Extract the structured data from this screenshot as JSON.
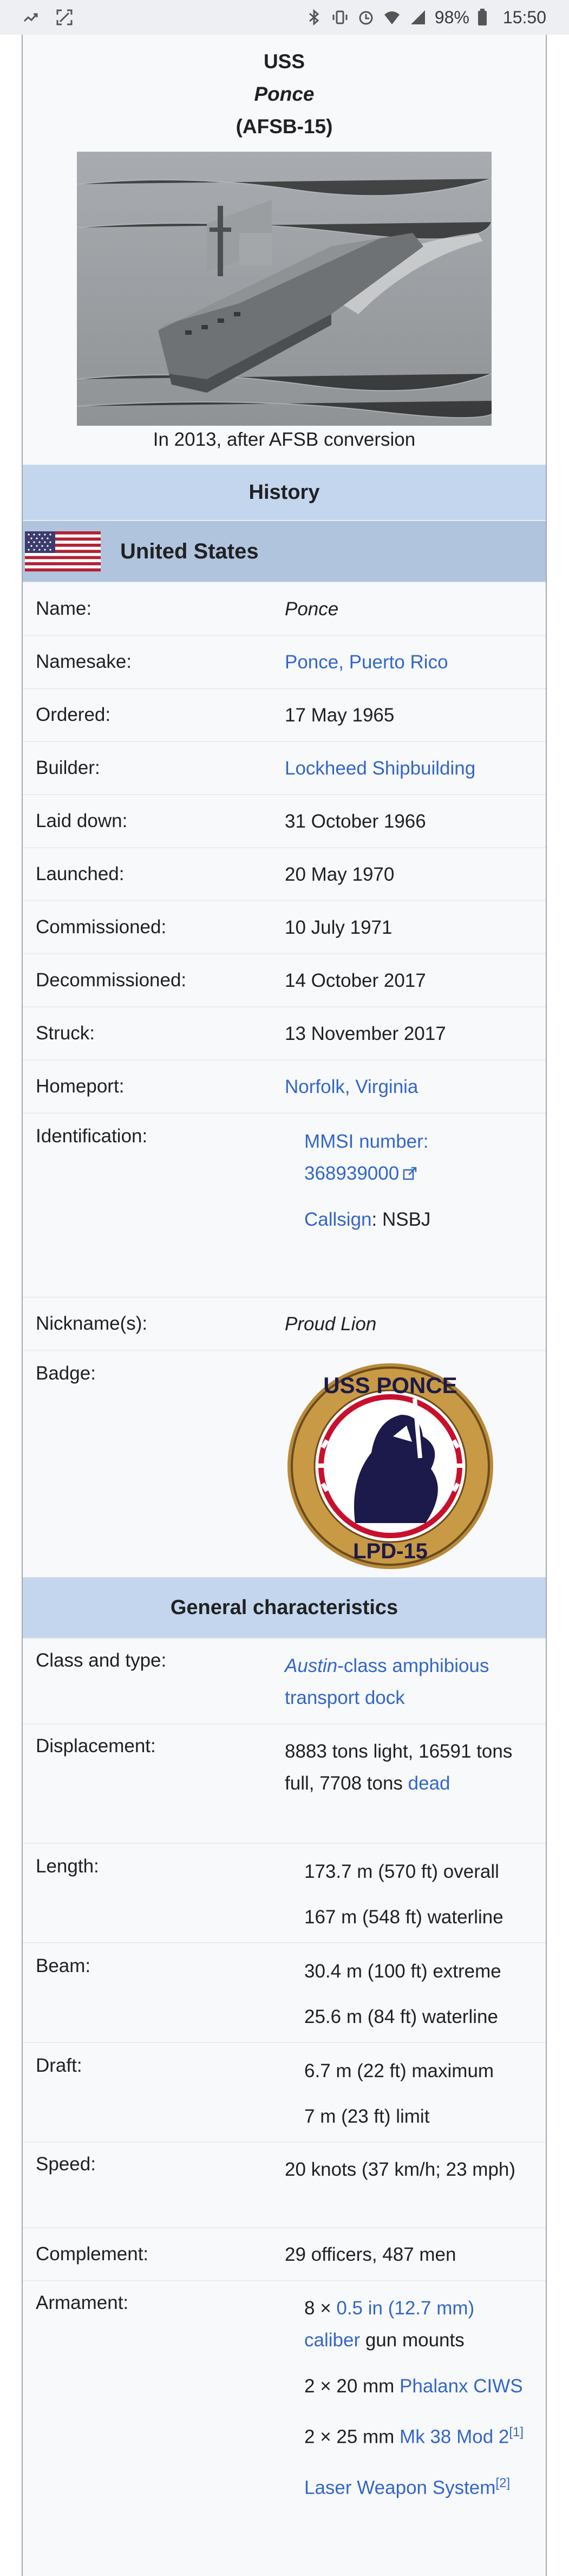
{
  "status": {
    "battery": "98%",
    "time": "15:50"
  },
  "infobox": {
    "title_prefix": "USS",
    "title_name": "Ponce",
    "title_hull": "(AFSB-15)",
    "caption": "In 2013, after AFSB conversion",
    "history_header": "History",
    "country": "United States",
    "history": {
      "name_label": "Name:",
      "name_value": "Ponce",
      "namesake_label": "Namesake:",
      "namesake_value": "Ponce, Puerto Rico",
      "ordered_label": "Ordered:",
      "ordered_value": "17 May 1965",
      "builder_label": "Builder:",
      "builder_value": "Lockheed Shipbuilding",
      "laid_label": "Laid down:",
      "laid_value": "31 October 1966",
      "launched_label": "Launched:",
      "launched_value": "20 May 1970",
      "commissioned_label": "Commissioned:",
      "commissioned_value": "10 July 1971",
      "decommissioned_label": "Decommissioned:",
      "decommissioned_value": "14 October 2017",
      "struck_label": "Struck:",
      "struck_value": "13 November 2017",
      "homeport_label": "Homeport:",
      "homeport_value": "Norfolk, Virginia",
      "ident_label": "Identification:",
      "mmsi_label": "MMSI number:",
      "mmsi_value": "368939000",
      "callsign_label": "Callsign",
      "callsign_value": ": NSBJ",
      "nickname_label": "Nickname(s):",
      "nickname_value": "Proud Lion",
      "badge_label": "Badge:",
      "badge_top_text": "USS PONCE",
      "badge_bottom_text": "LPD-15"
    },
    "general_header": "General characteristics",
    "general": {
      "class_label": "Class and type:",
      "class_italic": "Austin",
      "class_rest": "-class amphibious transport dock",
      "disp_label": "Displacement:",
      "disp_text": "8883 tons light, 16591 tons full, 7708 tons ",
      "disp_link": "dead",
      "length_label": "Length:",
      "length_1": "173.7 m (570 ft) overall",
      "length_2": "167 m (548 ft) waterline",
      "beam_label": "Beam:",
      "beam_1": "30.4 m (100 ft) extreme",
      "beam_2": "25.6 m (84 ft) waterline",
      "draft_label": "Draft:",
      "draft_1": "6.7 m (22 ft) maximum",
      "draft_2": "7 m (23 ft) limit",
      "speed_label": "Speed:",
      "speed_value": "20 knots (37 km/h; 23 mph)",
      "complement_label": "Complement:",
      "complement_value": "29 officers, 487 men",
      "armament_label": "Armament:",
      "arm1_pre": "8 × ",
      "arm1_link": "0.5 in (12.7 mm) caliber",
      "arm1_post": " gun mounts",
      "arm2_pre": "2 × 20 mm ",
      "arm2_link": "Phalanx CIWS",
      "arm3_pre": "2 × 25 mm ",
      "arm3_link": "Mk 38 Mod 2",
      "arm3_ref": "[1]",
      "arm4_link": "Laser Weapon System",
      "arm4_ref": "[2]"
    }
  }
}
